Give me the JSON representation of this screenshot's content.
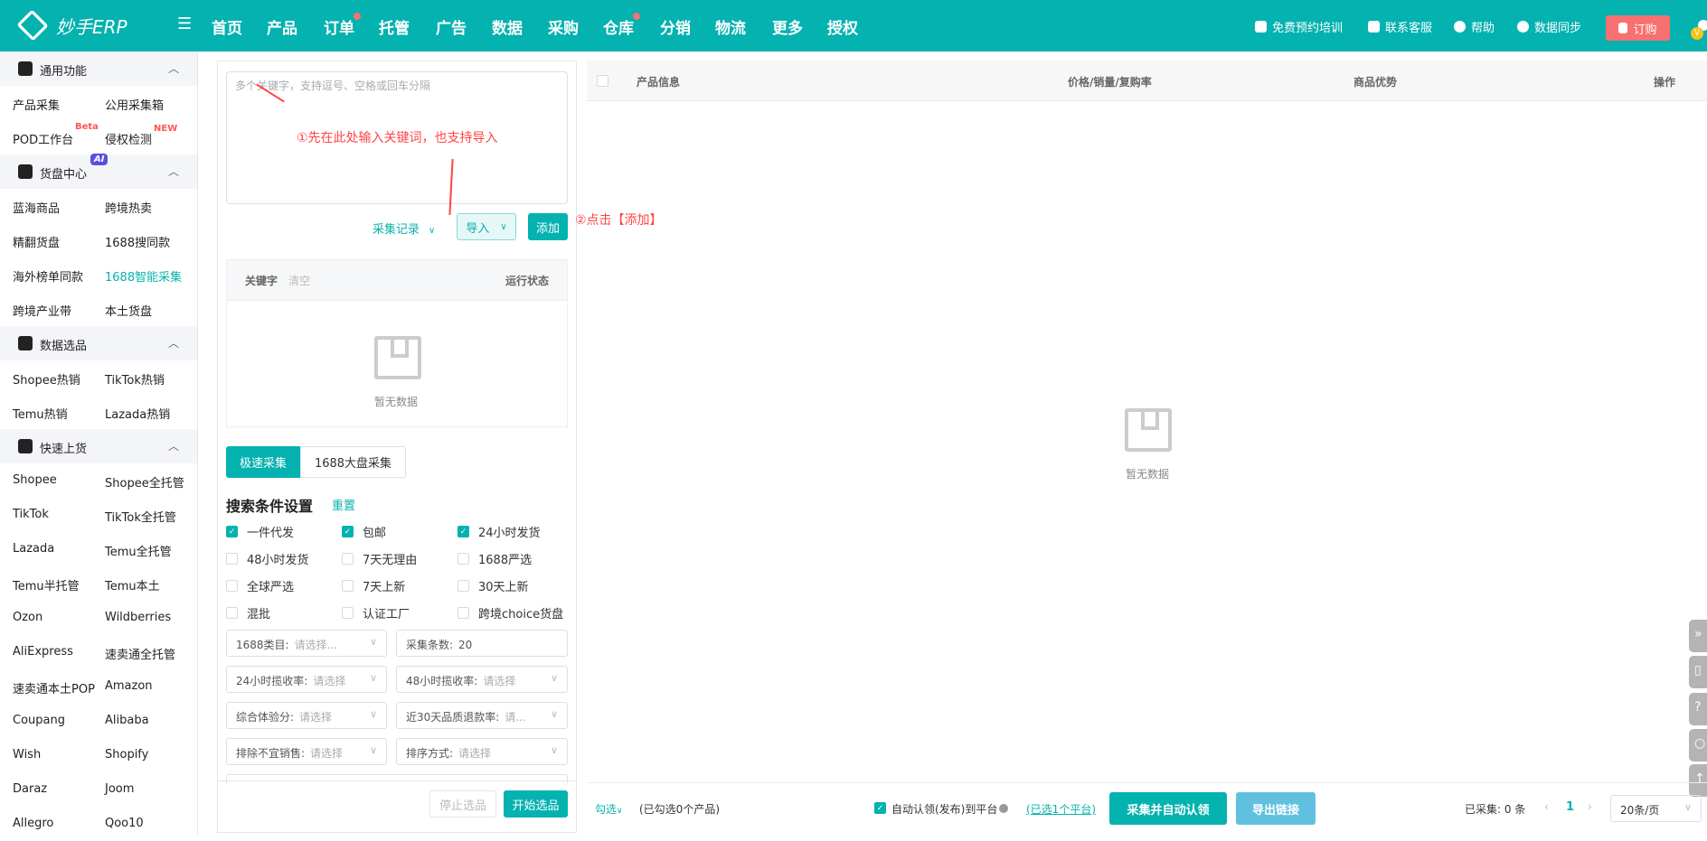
{
  "header": {
    "logo": "妙手ERP",
    "nav": [
      {
        "label": "首页"
      },
      {
        "label": "产品"
      },
      {
        "label": "订单",
        "dot": true
      },
      {
        "label": "托管"
      },
      {
        "label": "广告"
      },
      {
        "label": "数据"
      },
      {
        "label": "采购"
      },
      {
        "label": "仓库",
        "dot": true
      },
      {
        "label": "分销"
      },
      {
        "label": "物流"
      },
      {
        "label": "更多"
      },
      {
        "label": "授权"
      }
    ],
    "training": "免费预约培训",
    "support": "联系客服",
    "help": "帮助",
    "sync": "数据同步",
    "order": "订购",
    "vip_badge": "V"
  },
  "sidebar": {
    "sections": [
      {
        "title": "通用功能",
        "items": [
          [
            "产品采集",
            "公用采集箱"
          ],
          [
            "POD工作台",
            "侵权检测"
          ]
        ],
        "badges": {
          "pod": "Beta",
          "infringe": "NEW"
        }
      },
      {
        "title": "货盘中心",
        "ai_badge": "AI",
        "items": [
          [
            "蓝海商品",
            "跨境热卖"
          ],
          [
            "精翻货盘",
            "1688搜同款"
          ],
          [
            "海外榜单同款",
            "1688智能采集"
          ],
          [
            "跨境产业带",
            "本土货盘"
          ]
        ]
      },
      {
        "title": "数据选品",
        "items": [
          [
            "Shopee热销",
            "TikTok热销"
          ],
          [
            "Temu热销",
            "Lazada热销"
          ]
        ]
      },
      {
        "title": "快速上货",
        "items": [
          [
            "Shopee",
            "Shopee全托管"
          ],
          [
            "TikTok",
            "TikTok全托管"
          ],
          [
            "Lazada",
            "Temu全托管"
          ],
          [
            "Temu半托管",
            "Temu本土"
          ],
          [
            "Ozon",
            "Wildberries"
          ],
          [
            "AliExpress",
            "速卖通全托管"
          ],
          [
            "速卖通本土POP",
            "Amazon"
          ],
          [
            "Coupang",
            "Alibaba"
          ],
          [
            "Wish",
            "Shopify"
          ],
          [
            "Daraz",
            "Joom"
          ],
          [
            "Allegro",
            "Qoo10"
          ]
        ]
      }
    ],
    "active": "1688智能采集"
  },
  "panel": {
    "keyword_placeholder": "多个关键字，支持逗号、空格或回车分隔",
    "annotation1": "①先在此处输入关键词，也支持导入",
    "annotation2": "②点击【添加】",
    "history": "采集记录",
    "import": "导入",
    "add": "添加",
    "kw_table": {
      "keyword": "关键字",
      "clear": "清空",
      "status": "运行状态",
      "empty": "暂无数据"
    },
    "tabs": [
      "极速采集",
      "1688大盘采集"
    ],
    "conditions_title": "搜索条件设置",
    "reset": "重置",
    "checkboxes": [
      {
        "label": "一件代发",
        "checked": true
      },
      {
        "label": "包邮",
        "checked": true
      },
      {
        "label": "24小时发货",
        "checked": true
      },
      {
        "label": "48小时发货",
        "checked": false
      },
      {
        "label": "7天无理由",
        "checked": false
      },
      {
        "label": "1688严选",
        "checked": false
      },
      {
        "label": "全球严选",
        "checked": false
      },
      {
        "label": "7天上新",
        "checked": false
      },
      {
        "label": "30天上新",
        "checked": false
      },
      {
        "label": "混批",
        "checked": false
      },
      {
        "label": "认证工厂",
        "checked": false
      },
      {
        "label": "跨境choice货盘",
        "checked": false
      }
    ],
    "selects": [
      {
        "label": "1688类目:",
        "value": "请选择...",
        "placeholder": true
      },
      {
        "label": "采集条数:",
        "value": "20",
        "placeholder": false
      },
      {
        "label": "24小时揽收率:",
        "value": "请选择",
        "placeholder": true
      },
      {
        "label": "48小时揽收率:",
        "value": "请选择",
        "placeholder": true
      },
      {
        "label": "综合体验分:",
        "value": "请选择",
        "placeholder": true
      },
      {
        "label": "近30天品质退款率:",
        "value": "请...",
        "placeholder": true
      },
      {
        "label": "排除不宜销售:",
        "value": "请选择",
        "placeholder": true
      },
      {
        "label": "排序方式:",
        "value": "请选择",
        "placeholder": true
      }
    ],
    "stop": "停止选品",
    "start": "开始选品"
  },
  "table": {
    "columns": [
      "产品信息",
      "价格/销量/复购率",
      "商品优势",
      "操作"
    ],
    "empty": "暂无数据"
  },
  "footer": {
    "select": "勾选",
    "selected": "(已勾选0个产品)",
    "auto_claim": "自动认领(发布)到平台",
    "auto_claim_checked": true,
    "platforms": "(已选1个平台)",
    "collect_claim": "采集并自动认领",
    "export": "导出链接",
    "collected": "已采集: 0 条",
    "page": "1",
    "page_size": "20条/页"
  }
}
